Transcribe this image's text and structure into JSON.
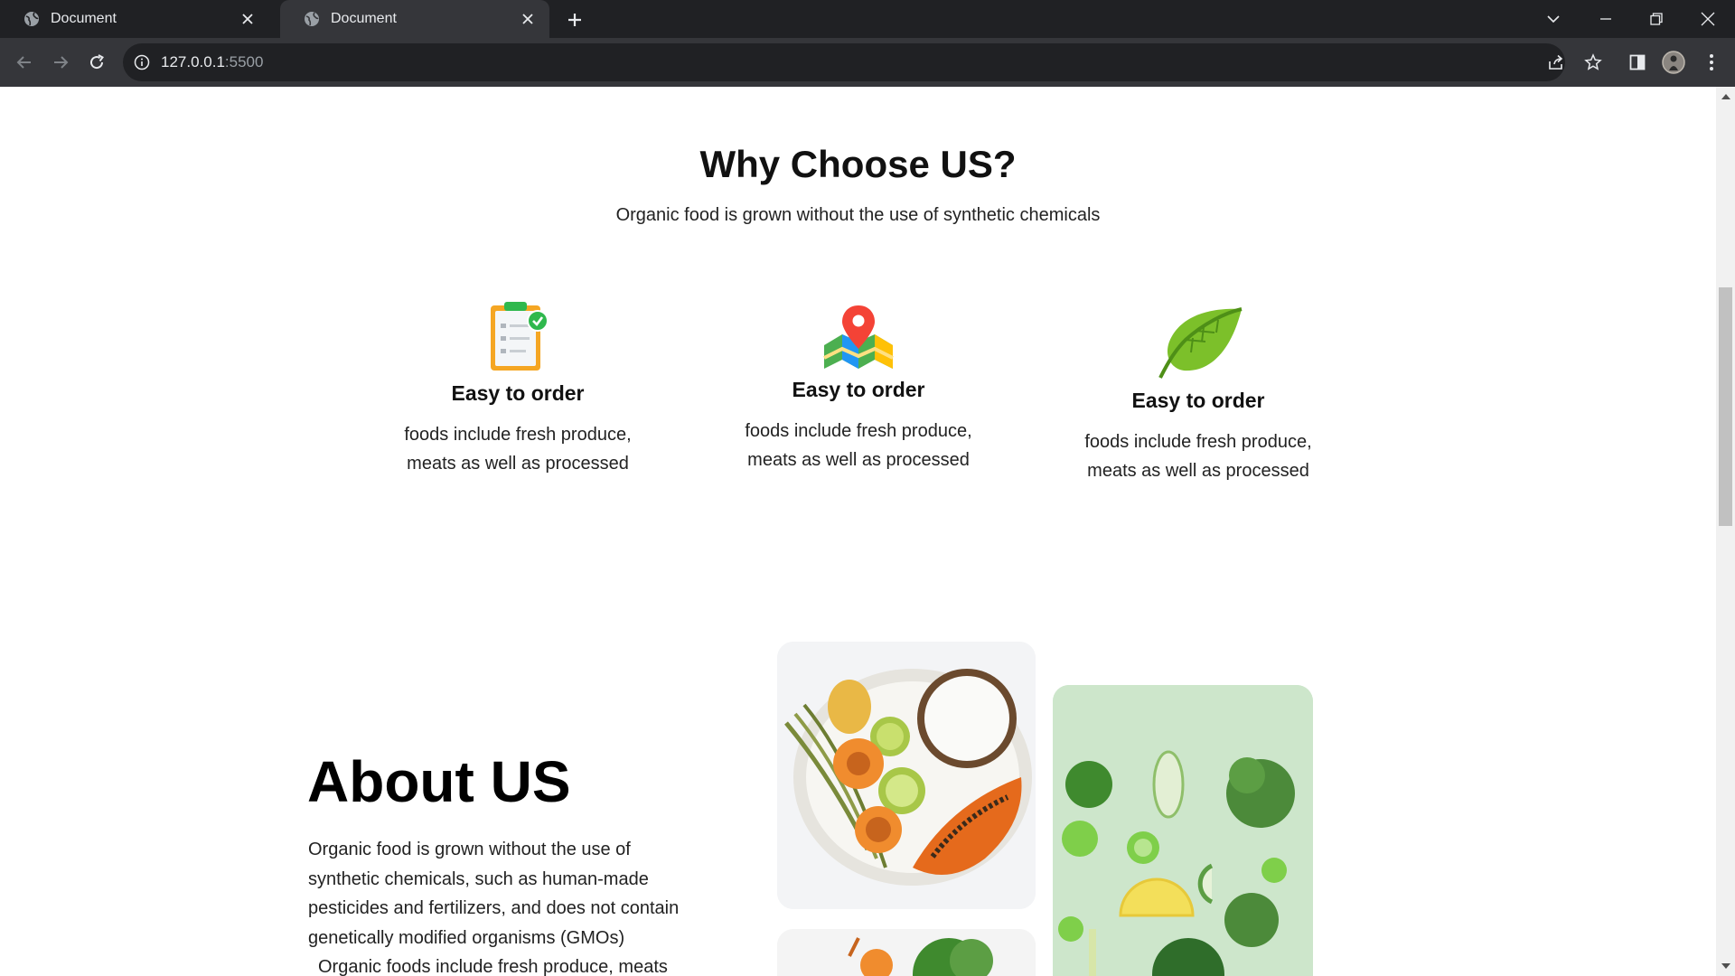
{
  "browser": {
    "tabs": [
      {
        "title": "Document",
        "active": false
      },
      {
        "title": "Document",
        "active": true
      }
    ],
    "url_host": "127.0.0.1",
    "url_port": ":5500"
  },
  "why": {
    "title": "Why Choose US?",
    "subtitle": "Organic food is grown without the use of synthetic chemicals",
    "features": [
      {
        "icon": "clipboard-check-icon",
        "title": "Easy to order",
        "text_line1": "foods include fresh produce,",
        "text_line2": "meats as well as processed"
      },
      {
        "icon": "map-pin-icon",
        "title": "Easy to order",
        "text_line1": "foods include fresh produce,",
        "text_line2": "meats as well as processed"
      },
      {
        "icon": "leaf-icon",
        "title": "Easy to order",
        "text_line1": "foods include fresh produce,",
        "text_line2": "meats as well as processed"
      }
    ]
  },
  "about": {
    "title": "About US",
    "paragraph": "Organic food is grown without the use of synthetic chemicals, such as human-made pesticides and fertilizers, and does not contain genetically modified organisms (GMOs)",
    "paragraph2": "Organic foods include fresh produce, meats"
  },
  "colors": {
    "chrome_dark": "#202124",
    "chrome_mid": "#35363a",
    "text": "#222222"
  }
}
